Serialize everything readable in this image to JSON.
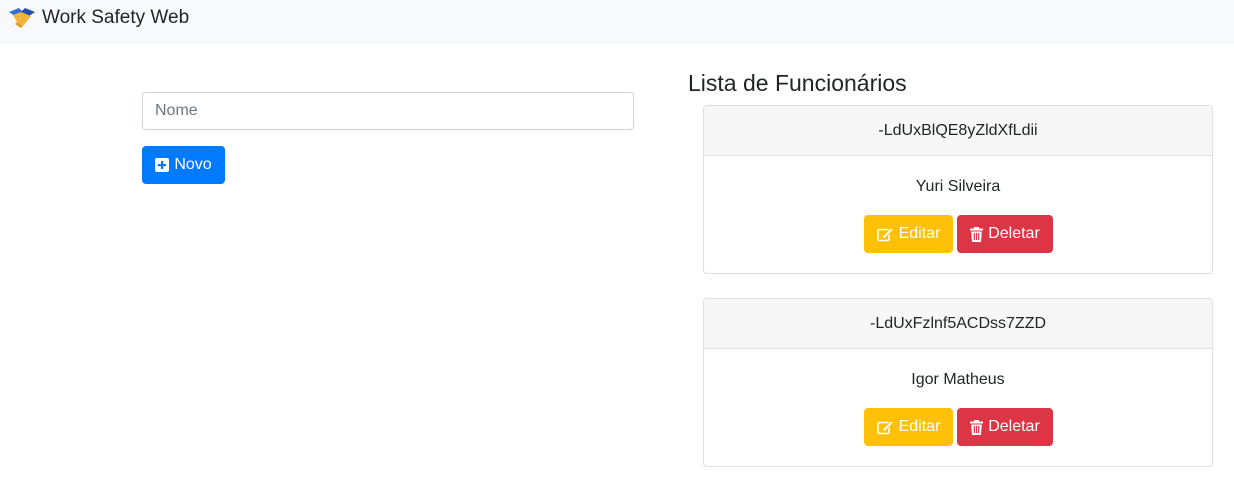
{
  "navbar": {
    "brand": "Work Safety Web",
    "logo_icon": "handshake-icon"
  },
  "form": {
    "name_placeholder": "Nome",
    "name_value": "",
    "new_button": {
      "label": "Novo",
      "icon": "plus-square-icon"
    }
  },
  "list": {
    "title": "Lista de Funcionários",
    "employees": [
      {
        "id": "-LdUxBlQE8yZldXfLdii",
        "name": "Yuri Silveira",
        "edit_label": "Editar",
        "delete_label": "Deletar"
      },
      {
        "id": "-LdUxFzlnf5ACDss7ZZD",
        "name": "Igor Matheus",
        "edit_label": "Editar",
        "delete_label": "Deletar"
      }
    ],
    "edit_icon": "edit-icon",
    "delete_icon": "trash-icon"
  },
  "colors": {
    "primary": "#007bff",
    "warning": "#ffc107",
    "danger": "#dc3545",
    "navbar_bg": "#f8f9fa"
  }
}
